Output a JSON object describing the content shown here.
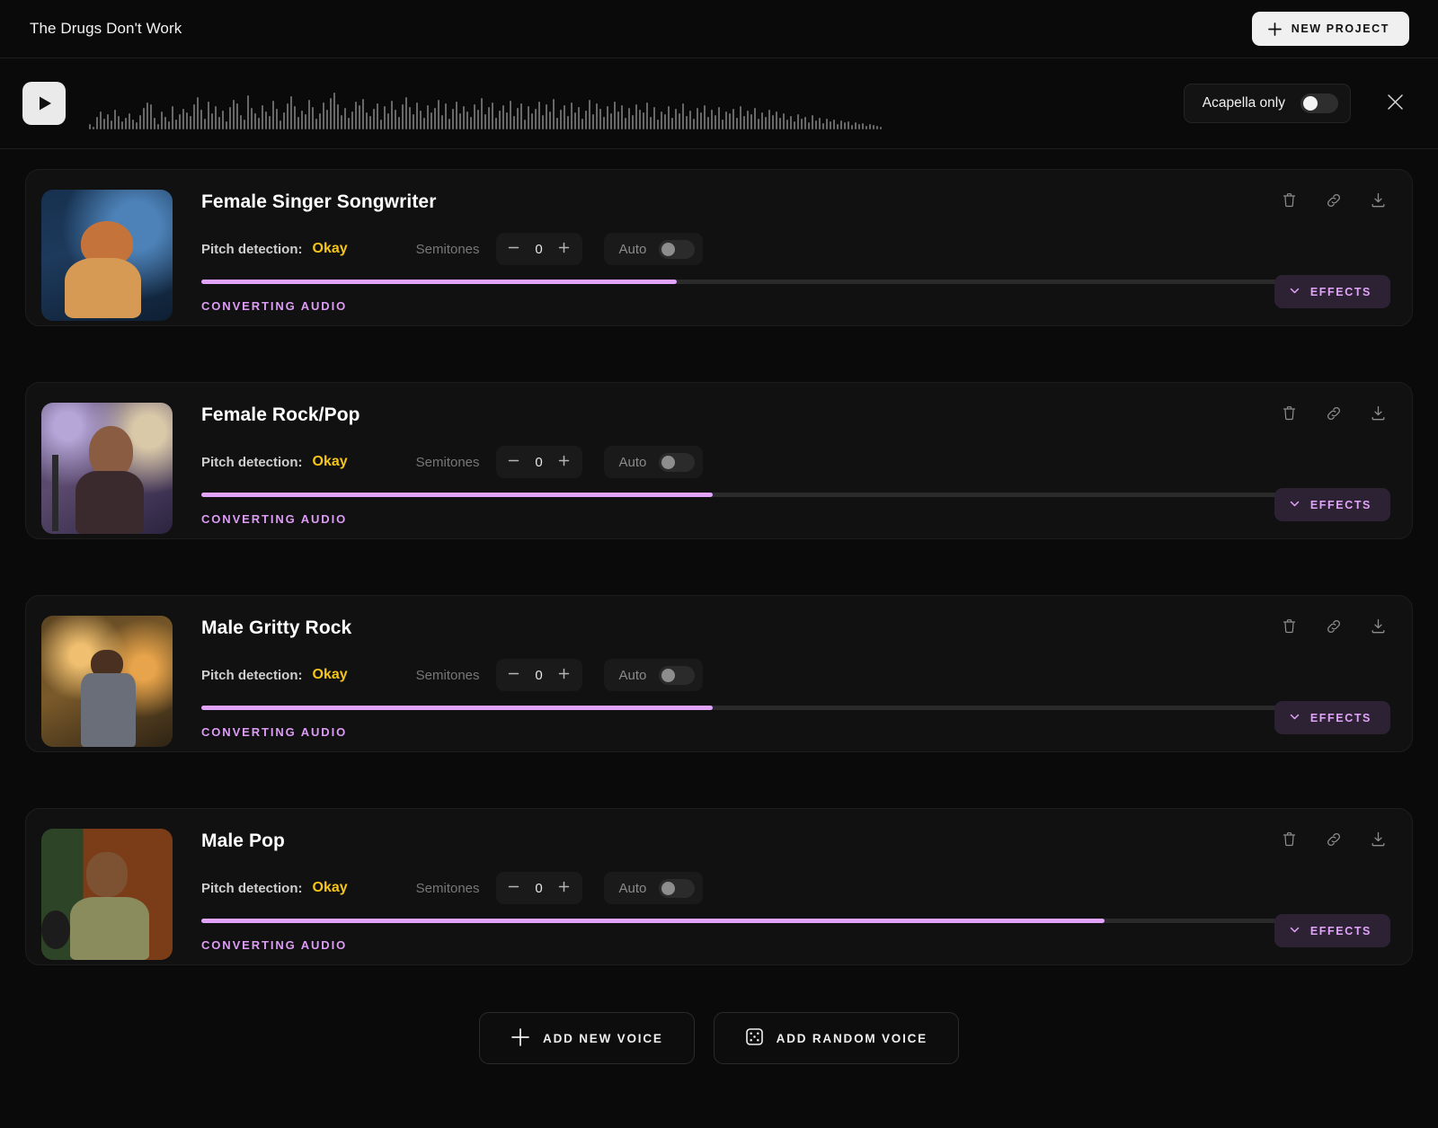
{
  "header": {
    "project_title": "The Drugs Don't Work",
    "new_project_label": "NEW PROJECT",
    "plus_icon": "plus-icon"
  },
  "player": {
    "play_icon": "play-icon",
    "acapella_label": "Acapella only",
    "acapella_on": false,
    "close_icon": "close-icon",
    "waveform_heights": [
      6,
      3,
      14,
      20,
      12,
      17,
      10,
      22,
      15,
      9,
      13,
      18,
      11,
      8,
      16,
      24,
      30,
      28,
      13,
      6,
      20,
      14,
      9,
      26,
      11,
      17,
      23,
      19,
      15,
      28,
      36,
      22,
      12,
      31,
      18,
      26,
      14,
      21,
      9,
      25,
      33,
      29,
      16,
      11,
      38,
      24,
      18,
      13,
      27,
      20,
      15,
      32,
      23,
      10,
      19,
      29,
      37,
      26,
      14,
      21,
      17,
      33,
      25,
      12,
      18,
      30,
      22,
      35,
      41,
      28,
      16,
      24,
      13,
      20,
      31,
      27,
      34,
      19,
      15,
      23,
      29,
      11,
      26,
      18,
      32,
      22,
      14,
      28,
      36,
      25,
      17,
      30,
      21,
      13,
      27,
      19,
      24,
      33,
      16,
      29,
      12,
      23,
      31,
      18,
      26,
      20,
      14,
      28,
      22,
      35,
      17,
      25,
      30,
      13,
      21,
      27,
      19,
      32,
      15,
      24,
      29,
      11,
      26,
      18,
      23,
      31,
      16,
      28,
      20,
      34,
      13,
      22,
      27,
      15,
      30,
      19,
      25,
      12,
      21,
      33,
      17,
      29,
      23,
      14,
      26,
      18,
      31,
      20,
      27,
      13,
      24,
      16,
      28,
      22,
      19,
      30,
      14,
      25,
      11,
      20,
      17,
      26,
      13,
      23,
      18,
      29,
      15,
      21,
      12,
      24,
      19,
      27,
      14,
      22,
      16,
      25,
      11,
      20,
      18,
      23,
      13,
      26,
      15,
      21,
      17,
      24,
      12,
      19,
      14,
      22,
      16,
      20,
      13,
      18,
      11,
      15,
      9,
      17,
      12,
      14,
      8,
      16,
      10,
      13,
      7,
      12,
      9,
      11,
      6,
      10,
      8,
      9,
      5,
      8,
      6,
      7,
      4,
      6,
      5,
      4,
      3
    ]
  },
  "cards": [
    {
      "name": "Female Singer Songwriter",
      "pitch_label": "Pitch detection:",
      "pitch_value": "Okay",
      "pitch_color": "#f5c518",
      "semitones_label": "Semitones",
      "semitones_value": "0",
      "auto_label": "Auto",
      "auto_on": false,
      "progress_percent": 40,
      "status": "CONVERTING AUDIO",
      "effects_label": "EFFECTS",
      "thumb_style": "singer-songwriter-guitar",
      "actions": [
        "trash-icon",
        "link-icon",
        "download-icon"
      ]
    },
    {
      "name": "Female Rock/Pop",
      "pitch_label": "Pitch detection:",
      "pitch_value": "Okay",
      "pitch_color": "#f5c518",
      "semitones_label": "Semitones",
      "semitones_value": "0",
      "auto_label": "Auto",
      "auto_on": false,
      "progress_percent": 43,
      "status": "CONVERTING AUDIO",
      "effects_label": "EFFECTS",
      "thumb_style": "rock-pop-stage",
      "actions": [
        "trash-icon",
        "link-icon",
        "download-icon"
      ]
    },
    {
      "name": "Male Gritty Rock",
      "pitch_label": "Pitch detection:",
      "pitch_value": "Okay",
      "pitch_color": "#f5c518",
      "semitones_label": "Semitones",
      "semitones_value": "0",
      "auto_label": "Auto",
      "auto_on": false,
      "progress_percent": 43,
      "status": "CONVERTING AUDIO",
      "effects_label": "EFFECTS",
      "thumb_style": "gritty-rock-studio",
      "actions": [
        "trash-icon",
        "link-icon",
        "download-icon"
      ]
    },
    {
      "name": "Male Pop",
      "pitch_label": "Pitch detection:",
      "pitch_value": "Okay",
      "pitch_color": "#f5c518",
      "semitones_label": "Semitones",
      "semitones_value": "0",
      "auto_label": "Auto",
      "auto_on": false,
      "progress_percent": 76,
      "status": "CONVERTING AUDIO",
      "effects_label": "EFFECTS",
      "thumb_style": "male-pop-booth",
      "actions": [
        "trash-icon",
        "link-icon",
        "download-icon"
      ]
    }
  ],
  "footer": {
    "add_new_voice_label": "ADD NEW VOICE",
    "add_random_voice_label": "ADD RANDOM VOICE",
    "plus_icon": "plus-icon",
    "dice_icon": "dice-icon"
  },
  "colors": {
    "accent_purple": "#e2a3fb",
    "pitch_yellow": "#f5c518",
    "background": "#0a0a0a",
    "card_background": "#111111"
  }
}
